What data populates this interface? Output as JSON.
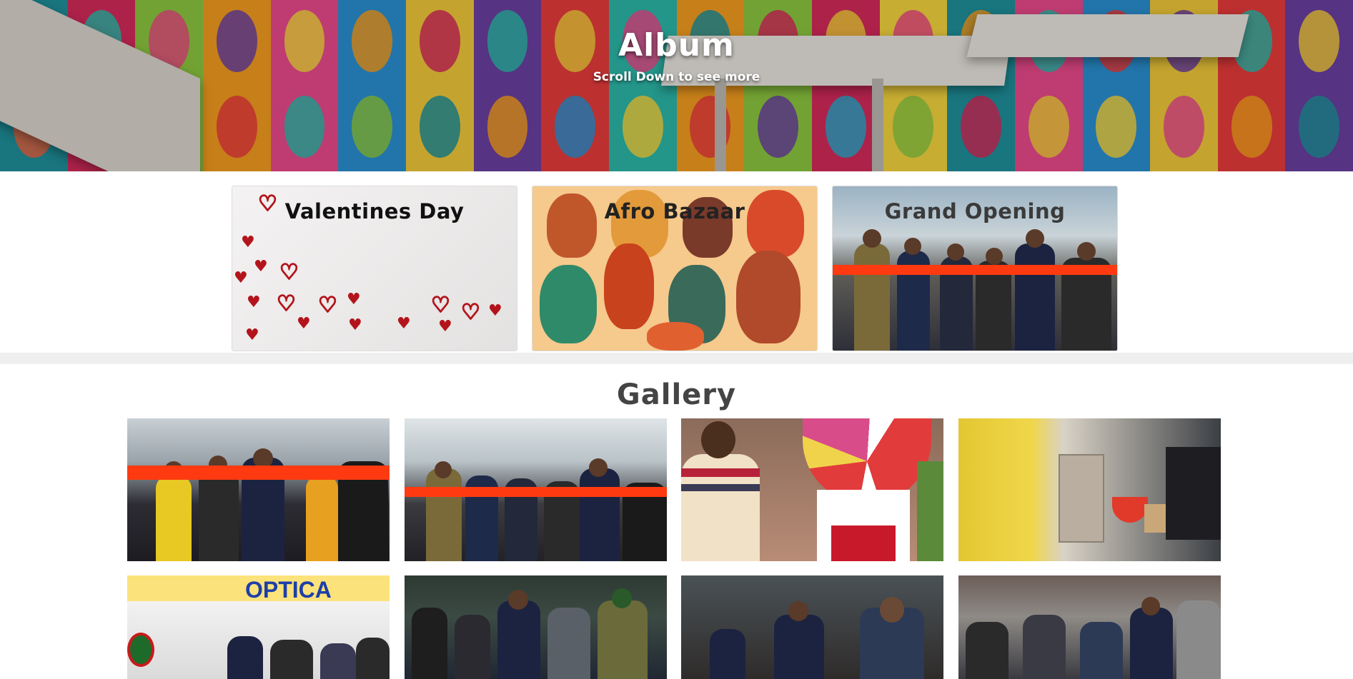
{
  "hero": {
    "title": "Album",
    "subtitle": "Scroll Down to see more"
  },
  "albums": [
    {
      "label": "Valentines Day"
    },
    {
      "label": "Afro Bazaar"
    },
    {
      "label": "Grand Opening"
    }
  ],
  "gallery": {
    "title": "Gallery",
    "photos": [
      {
        "alt": "ribbon-cutting-1"
      },
      {
        "alt": "ribbon-cutting-2"
      },
      {
        "alt": "spin-wheel-stand"
      },
      {
        "alt": "perfume-display"
      },
      {
        "alt": "optica-store"
      },
      {
        "alt": "tour-group"
      },
      {
        "alt": "restaurant-visit"
      },
      {
        "alt": "christmas-walkthrough"
      }
    ],
    "optica_sign": "OPTICA"
  },
  "colors": {
    "ribbon": "#ff3a10",
    "heart": "#b3141b",
    "divider": "#efefef",
    "gallery_title": "#444444"
  }
}
